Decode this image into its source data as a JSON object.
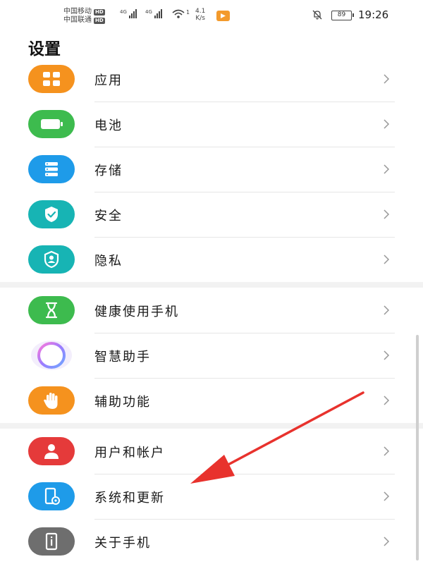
{
  "status_bar": {
    "carrier_1": "中国移动",
    "carrier_2": "中国联通",
    "hd_label": "HD",
    "network_1": "4G",
    "network_2": "4G",
    "wifi_count": "1",
    "net_speed_value": "4.1",
    "net_speed_unit": "K/s",
    "battery_level": "89",
    "time": "19:26"
  },
  "header": {
    "title": "设置"
  },
  "settings_items": [
    {
      "label": "应用",
      "icon": "apps-grid-icon",
      "color": "#f5921e"
    },
    {
      "label": "电池",
      "icon": "battery-icon",
      "color": "#3dbb4e"
    },
    {
      "label": "存储",
      "icon": "storage-icon",
      "color": "#1e9be9"
    },
    {
      "label": "安全",
      "icon": "shield-check-icon",
      "color": "#17b4b4"
    },
    {
      "label": "隐私",
      "icon": "privacy-shield-icon",
      "color": "#17b4b4"
    },
    {
      "label": "健康使用手机",
      "icon": "hourglass-icon",
      "color": "#3dbb4e"
    },
    {
      "label": "智慧助手",
      "icon": "smart-assistant-icon",
      "color": "#a67cf0"
    },
    {
      "label": "辅助功能",
      "icon": "hand-icon",
      "color": "#f5921e"
    },
    {
      "label": "用户和帐户",
      "icon": "user-icon",
      "color": "#e53a3a"
    },
    {
      "label": "系统和更新",
      "icon": "system-update-icon",
      "color": "#1e9be9"
    },
    {
      "label": "关于手机",
      "icon": "info-icon",
      "color": "#6e6e6e"
    }
  ],
  "colors": {
    "annotation_arrow": "#e8322d"
  }
}
